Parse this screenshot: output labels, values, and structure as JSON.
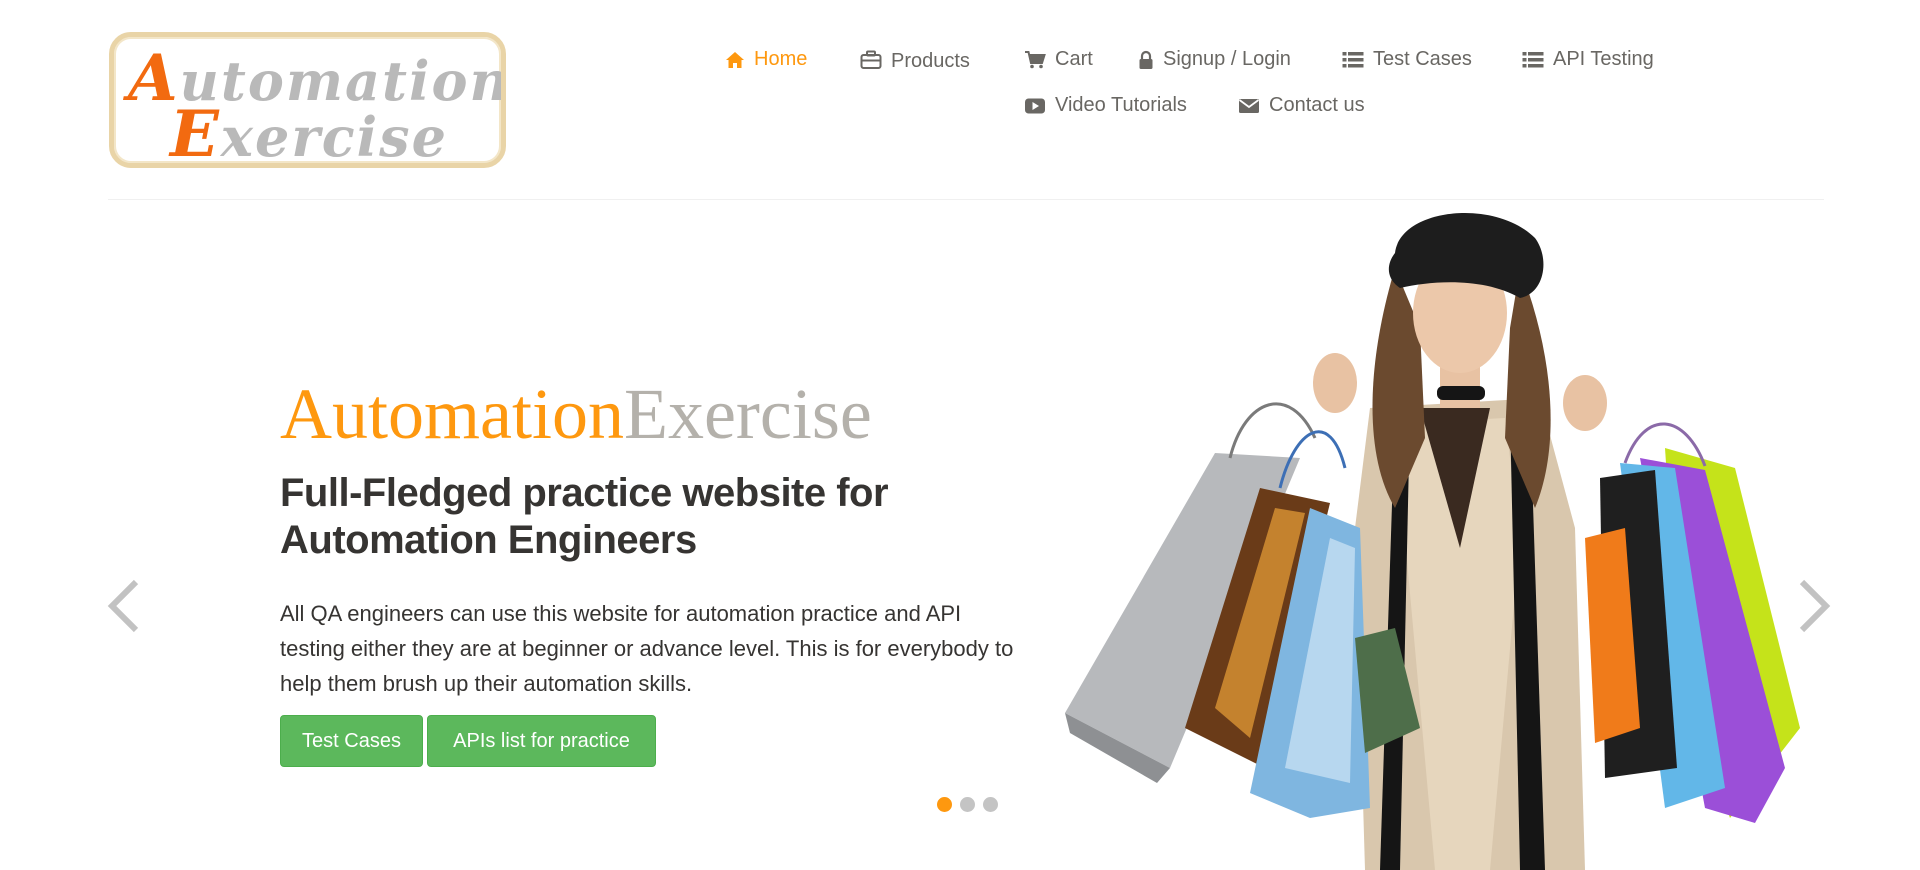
{
  "logo": {
    "line1_first": "A",
    "line1_rest": "utomation",
    "line2_first": "E",
    "line2_rest": "xercise"
  },
  "nav": {
    "items": [
      {
        "label": "Home",
        "icon": "home-icon",
        "active": true
      },
      {
        "label": "Products",
        "icon": "briefcase-icon"
      },
      {
        "label": "Cart",
        "icon": "cart-icon"
      },
      {
        "label": "Signup / Login",
        "icon": "lock-icon"
      },
      {
        "label": "Test Cases",
        "icon": "list-icon"
      },
      {
        "label": "API Testing",
        "icon": "list-icon"
      },
      {
        "label": "Video Tutorials",
        "icon": "youtube-icon"
      },
      {
        "label": "Contact us",
        "icon": "envelope-icon"
      }
    ]
  },
  "hero": {
    "brand_part1": "Automation",
    "brand_part2": "Exercise",
    "headline": "Full-Fledged practice website for Automation Engineers",
    "description": "All QA engineers can use this website for automation practice and API testing either they are at beginner or advance level. This is for everybody to help them brush up their automation skills.",
    "button_test_cases": "Test Cases",
    "button_apis": "APIs list for practice",
    "active_slide": 1,
    "slide_count": 3
  },
  "colors": {
    "accent": "#fe980f",
    "text": "#696763",
    "dark": "#363432",
    "button": "#5cb85c",
    "brand_grey": "#b4b1ab"
  }
}
